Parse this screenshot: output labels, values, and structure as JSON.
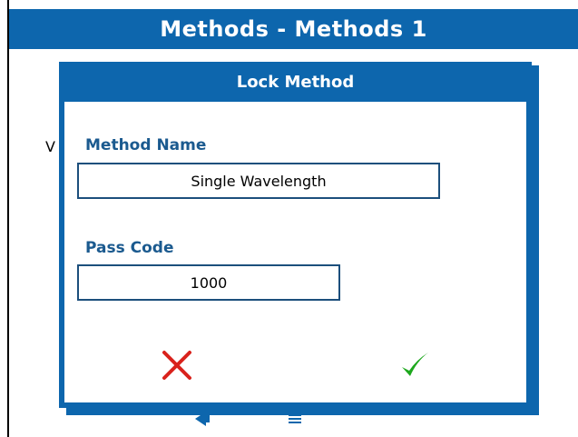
{
  "window": {
    "title": "Methods - Methods 1",
    "background_fragment": "V"
  },
  "dialog": {
    "title": "Lock Method",
    "method_name": {
      "label": "Method Name",
      "value": "Single Wavelength"
    },
    "pass_code": {
      "label": "Pass Code",
      "value": "1000"
    },
    "cancel_icon": "x-icon",
    "confirm_icon": "check-icon"
  },
  "colors": {
    "accent": "#0d66ad",
    "label": "#1b5a8f",
    "cancel": "#d9221c",
    "confirm": "#1ea81e"
  }
}
